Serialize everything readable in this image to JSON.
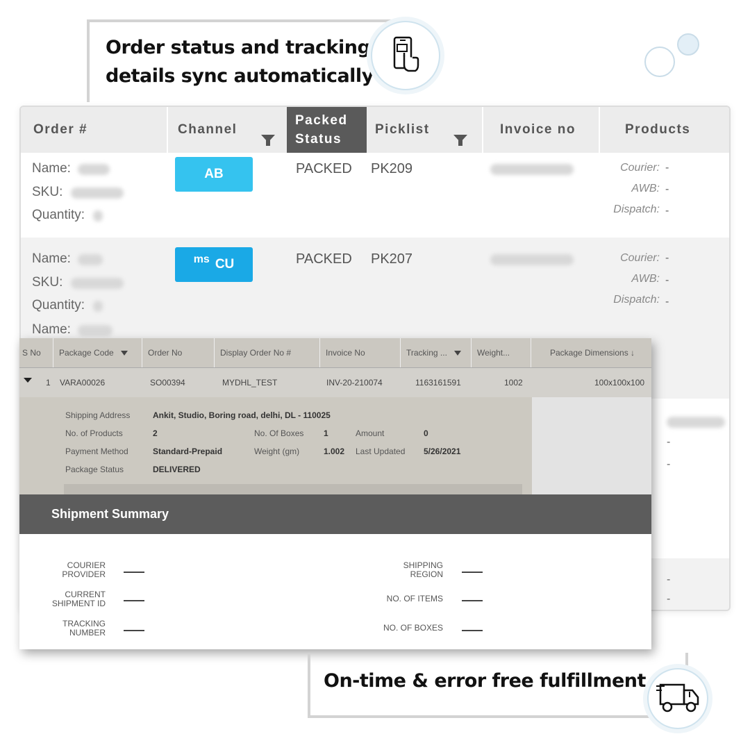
{
  "callouts": {
    "top_line1": "Order status and tracking",
    "top_line2": "details sync automatically",
    "bottom": "On-time & error free fulfillment"
  },
  "orders_table": {
    "columns": {
      "order": "Order #",
      "channel": "Channel",
      "packed_status_line1": "Packed",
      "packed_status_line2": "Status",
      "picklist": "Picklist",
      "invoice": "Invoice no",
      "products": "Products"
    },
    "labels": {
      "name": "Name:",
      "sku": "SKU:",
      "quantity": "Quantity:",
      "courier": "Courier:",
      "awb": "AWB:",
      "dispatch": "Dispatch:",
      "dash": "-"
    },
    "rows": [
      {
        "channel_badge": "AB",
        "channel_badge_prefix": "",
        "status": "PACKED",
        "picklist": "PK209"
      },
      {
        "channel_badge": "CU",
        "channel_badge_prefix": "ms",
        "status": "PACKED",
        "picklist": "PK207"
      }
    ]
  },
  "package_table": {
    "columns": {
      "sno": "S No",
      "package_code": "Package Code",
      "order_no": "Order No",
      "display_order_no": "Display Order No #",
      "invoice_no": "Invoice No",
      "tracking": "Tracking ...",
      "weight": "Weight...",
      "dimensions": "Package Dimensions ↓"
    },
    "row": {
      "sno": "1",
      "package_code": "VARA00026",
      "order_no": "SO00394",
      "display_order_no": "MYDHL_TEST",
      "invoice_no": "INV-20-210074",
      "tracking": "1163161591",
      "weight": "1002",
      "dimensions": "100x100x100"
    },
    "details": {
      "shipping_address_label": "Shipping Address",
      "shipping_address": "Ankit, Studio, Boring road, delhi, DL - 110025",
      "no_products_label": "No. of Products",
      "no_products": "2",
      "no_boxes_label": "No. Of Boxes",
      "no_boxes": "1",
      "amount_label": "Amount",
      "amount": "0",
      "payment_method_label": "Payment Method",
      "payment_method": "Standard-Prepaid",
      "weight_label": "Weight (gm)",
      "weight": "1.002",
      "last_updated_label": "Last Updated",
      "last_updated": "5/26/2021",
      "package_status_label": "Package Status",
      "package_status": "DELIVERED"
    }
  },
  "shipment_summary": {
    "title": "Shipment Summary",
    "courier_provider_l1": "COURIER",
    "courier_provider_l2": "PROVIDER",
    "current_shipment_l1": "CURRENT",
    "current_shipment_l2": "SHIPMENT ID",
    "tracking_number_l1": "TRACKING",
    "tracking_number_l2": "NUMBER",
    "shipping_region_l1": "SHIPPING",
    "shipping_region_l2": "REGION",
    "no_items": "NO. OF ITEMS",
    "no_boxes": "NO. OF BOXES"
  },
  "icons": [
    "mobile-tap-icon",
    "delivery-truck-icon",
    "filter-icon",
    "expand-arrow-icon"
  ],
  "colors": {
    "channel_badge": "#35c3ef",
    "active_header": "#5a5a5a",
    "summary_bar": "#5c5c5c"
  }
}
